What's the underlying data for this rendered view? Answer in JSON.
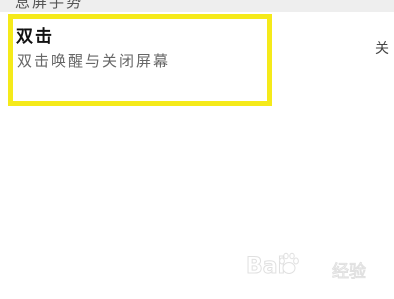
{
  "section": {
    "title": "息屏手势"
  },
  "setting": {
    "title": "双击",
    "description": "双击唤醒与关闭屏幕",
    "state": "关"
  },
  "watermark": {
    "brand_prefix": "Bai",
    "brand_suffix": "经验",
    "icon": "paw-icon"
  },
  "colors": {
    "highlight": "#f5ea1a",
    "section_bg": "#eeeeee"
  }
}
